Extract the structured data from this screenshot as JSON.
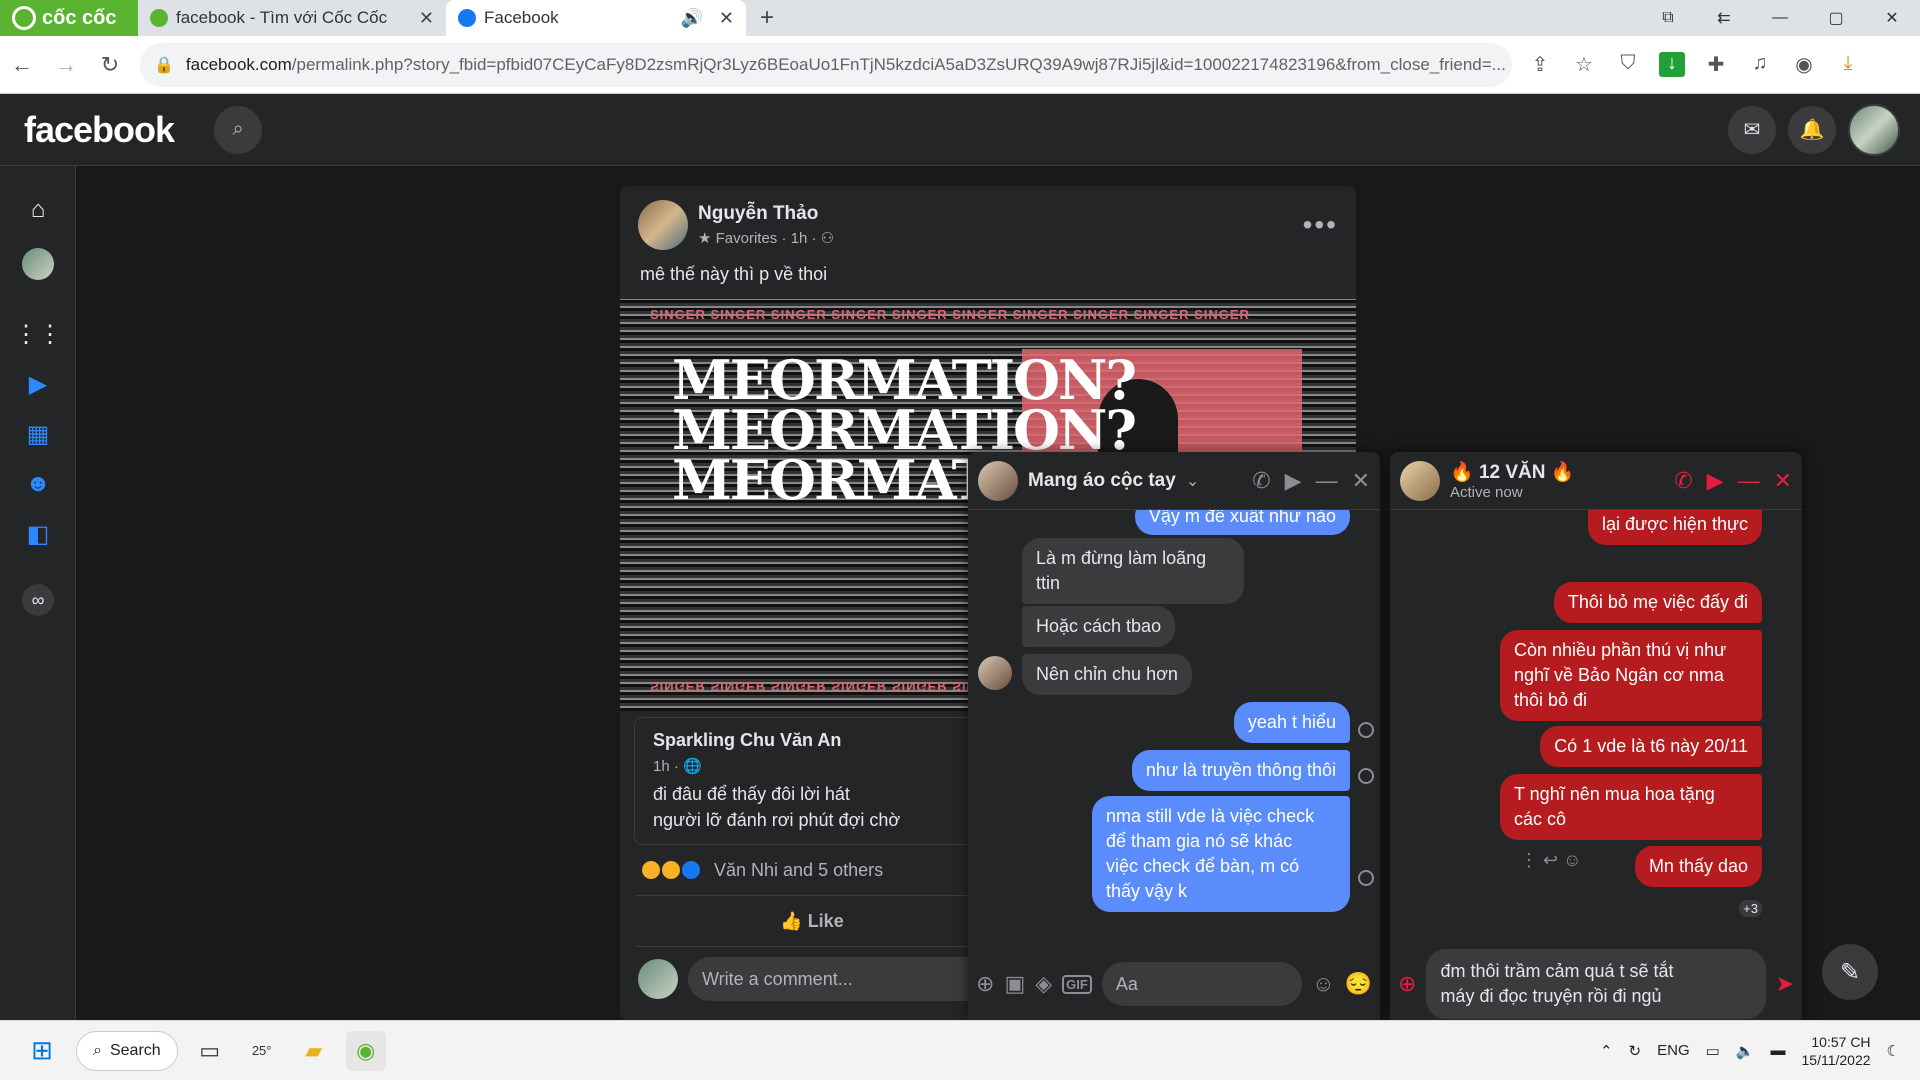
{
  "browser": {
    "brand": "cốc cốc",
    "tabs": [
      {
        "label": "facebook - Tìm với Cốc Cốc",
        "active": false
      },
      {
        "label": "Facebook",
        "active": true
      }
    ],
    "url_host": "facebook.com",
    "url_path": "/permalink.php?story_fbid=pfbid07CEyCaFy8D2zsmRjQr3Lyz6BEoaUo1FnTjN5kzdciA5aD3ZsURQ39A9wj87RJi5jl&id=100022174823196&from_close_friend=..."
  },
  "fb": {
    "logo": "facebook"
  },
  "post": {
    "author": "Nguyễn Thảo",
    "meta": "Favorites · 1h ·",
    "text": "mê thế này thì p về thoi",
    "image_big_text": "MEORMATION?",
    "image_strip": "SINGER SINGER SINGER SINGER SINGER SINGER SINGER SINGER SINGER SINGER",
    "shared": {
      "author": "Sparkling Chu Văn An",
      "meta": "1h ·",
      "text": "đi đâu để thấy đôi lời hát\nngười lỡ đánh rơi phút đợi chờ"
    },
    "reactions_text": "Văn Nhi and 5 others",
    "like_label": "Like",
    "comment_placeholder": "Write a comment..."
  },
  "chat1": {
    "title": "Mang áo cộc tay",
    "messages": [
      "Vậy m đề xuất như nào",
      "Là m đừng làm loãng\nttin",
      "Hoặc cách tbao",
      "Nên chỉn chu hơn",
      "yeah t hiểu",
      "như là truyền thông thôi",
      "nma still vde là việc check\nđể tham gia nó sẽ khác\nviệc check để bàn, m có\nthấy vậy k"
    ],
    "input_placeholder": "Aa"
  },
  "chat2": {
    "title": "12 VĂN",
    "status": "Active now",
    "messages": [
      "lại được hiện thực",
      "Thôi bỏ mẹ việc đấy đi",
      "Còn nhiều phần thú vị như\nnghĩ về Bảo Ngân cơ nma\nthôi bỏ đi",
      "Có 1 vde là t6 này 20/11",
      "T nghĩ nên mua hoa tặng\ncác cô",
      "Mn thấy dao"
    ],
    "seen_extra": "+3",
    "draft": "đm thôi trầm cảm quá t sẽ tắt\nmáy đi đọc truyện rồi đi ngủ"
  },
  "taskbar": {
    "search_label": "Search",
    "weather": "25°",
    "lang": "ENG",
    "time": "10:57 CH",
    "date": "15/11/2022"
  },
  "colors": {
    "fb_dark": "#18191a",
    "card": "#242526",
    "blue_bubble": "#5b8cfc",
    "red_bubble": "#b51b1f",
    "coccoc_green": "#5bb431"
  }
}
